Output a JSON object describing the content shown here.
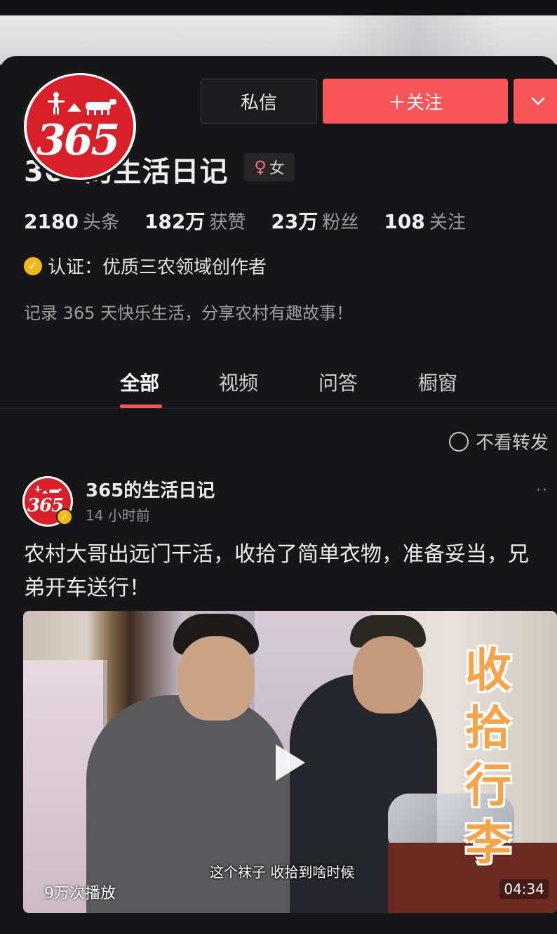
{
  "header": {
    "avatar_text": "365",
    "message_button": "私信",
    "follow_button": "＋关注"
  },
  "profile": {
    "name": "365的生活日记",
    "gender_symbol": "♀",
    "gender": "女",
    "stats": [
      {
        "value": "2180",
        "label": "头条"
      },
      {
        "value": "182万",
        "label": "获赞"
      },
      {
        "value": "23万",
        "label": "粉丝"
      },
      {
        "value": "108",
        "label": "关注"
      }
    ],
    "verification": "认证：优质三农领域创作者",
    "bio": "记录 365 天快乐生活，分享农村有趣故事！"
  },
  "tabs": [
    "全部",
    "视频",
    "问答",
    "橱窗"
  ],
  "filter_label": "不看转发",
  "post": {
    "author": "365的生活日记",
    "time": "14 小时前",
    "avatar_text": "365",
    "text": "农村大哥出远门干活，收拾了简单衣物，准备妥当，兄弟开车送行！",
    "video": {
      "overlay_chars": [
        "收",
        "拾",
        "行",
        "李"
      ],
      "subtitle": "这个袜子 收拾到啥时候",
      "play_count": "9万次播放",
      "duration": "04:34"
    }
  },
  "colors": {
    "accent": "#f75558",
    "verify_badge": "#f3b817",
    "background": "#161618"
  }
}
